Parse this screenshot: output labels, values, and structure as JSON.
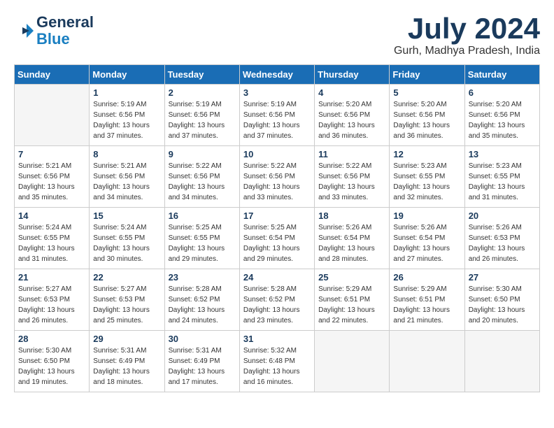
{
  "header": {
    "logo_line1": "General",
    "logo_line2": "Blue",
    "month": "July 2024",
    "location": "Gurh, Madhya Pradesh, India"
  },
  "weekdays": [
    "Sunday",
    "Monday",
    "Tuesday",
    "Wednesday",
    "Thursday",
    "Friday",
    "Saturday"
  ],
  "weeks": [
    [
      {
        "day": "",
        "sunrise": "",
        "sunset": "",
        "daylight": ""
      },
      {
        "day": "1",
        "sunrise": "5:19 AM",
        "sunset": "6:56 PM",
        "daylight": "13 hours and 37 minutes."
      },
      {
        "day": "2",
        "sunrise": "5:19 AM",
        "sunset": "6:56 PM",
        "daylight": "13 hours and 37 minutes."
      },
      {
        "day": "3",
        "sunrise": "5:19 AM",
        "sunset": "6:56 PM",
        "daylight": "13 hours and 37 minutes."
      },
      {
        "day": "4",
        "sunrise": "5:20 AM",
        "sunset": "6:56 PM",
        "daylight": "13 hours and 36 minutes."
      },
      {
        "day": "5",
        "sunrise": "5:20 AM",
        "sunset": "6:56 PM",
        "daylight": "13 hours and 36 minutes."
      },
      {
        "day": "6",
        "sunrise": "5:20 AM",
        "sunset": "6:56 PM",
        "daylight": "13 hours and 35 minutes."
      }
    ],
    [
      {
        "day": "7",
        "sunrise": "5:21 AM",
        "sunset": "6:56 PM",
        "daylight": "13 hours and 35 minutes."
      },
      {
        "day": "8",
        "sunrise": "5:21 AM",
        "sunset": "6:56 PM",
        "daylight": "13 hours and 34 minutes."
      },
      {
        "day": "9",
        "sunrise": "5:22 AM",
        "sunset": "6:56 PM",
        "daylight": "13 hours and 34 minutes."
      },
      {
        "day": "10",
        "sunrise": "5:22 AM",
        "sunset": "6:56 PM",
        "daylight": "13 hours and 33 minutes."
      },
      {
        "day": "11",
        "sunrise": "5:22 AM",
        "sunset": "6:56 PM",
        "daylight": "13 hours and 33 minutes."
      },
      {
        "day": "12",
        "sunrise": "5:23 AM",
        "sunset": "6:55 PM",
        "daylight": "13 hours and 32 minutes."
      },
      {
        "day": "13",
        "sunrise": "5:23 AM",
        "sunset": "6:55 PM",
        "daylight": "13 hours and 31 minutes."
      }
    ],
    [
      {
        "day": "14",
        "sunrise": "5:24 AM",
        "sunset": "6:55 PM",
        "daylight": "13 hours and 31 minutes."
      },
      {
        "day": "15",
        "sunrise": "5:24 AM",
        "sunset": "6:55 PM",
        "daylight": "13 hours and 30 minutes."
      },
      {
        "day": "16",
        "sunrise": "5:25 AM",
        "sunset": "6:55 PM",
        "daylight": "13 hours and 29 minutes."
      },
      {
        "day": "17",
        "sunrise": "5:25 AM",
        "sunset": "6:54 PM",
        "daylight": "13 hours and 29 minutes."
      },
      {
        "day": "18",
        "sunrise": "5:26 AM",
        "sunset": "6:54 PM",
        "daylight": "13 hours and 28 minutes."
      },
      {
        "day": "19",
        "sunrise": "5:26 AM",
        "sunset": "6:54 PM",
        "daylight": "13 hours and 27 minutes."
      },
      {
        "day": "20",
        "sunrise": "5:26 AM",
        "sunset": "6:53 PM",
        "daylight": "13 hours and 26 minutes."
      }
    ],
    [
      {
        "day": "21",
        "sunrise": "5:27 AM",
        "sunset": "6:53 PM",
        "daylight": "13 hours and 26 minutes."
      },
      {
        "day": "22",
        "sunrise": "5:27 AM",
        "sunset": "6:53 PM",
        "daylight": "13 hours and 25 minutes."
      },
      {
        "day": "23",
        "sunrise": "5:28 AM",
        "sunset": "6:52 PM",
        "daylight": "13 hours and 24 minutes."
      },
      {
        "day": "24",
        "sunrise": "5:28 AM",
        "sunset": "6:52 PM",
        "daylight": "13 hours and 23 minutes."
      },
      {
        "day": "25",
        "sunrise": "5:29 AM",
        "sunset": "6:51 PM",
        "daylight": "13 hours and 22 minutes."
      },
      {
        "day": "26",
        "sunrise": "5:29 AM",
        "sunset": "6:51 PM",
        "daylight": "13 hours and 21 minutes."
      },
      {
        "day": "27",
        "sunrise": "5:30 AM",
        "sunset": "6:50 PM",
        "daylight": "13 hours and 20 minutes."
      }
    ],
    [
      {
        "day": "28",
        "sunrise": "5:30 AM",
        "sunset": "6:50 PM",
        "daylight": "13 hours and 19 minutes."
      },
      {
        "day": "29",
        "sunrise": "5:31 AM",
        "sunset": "6:49 PM",
        "daylight": "13 hours and 18 minutes."
      },
      {
        "day": "30",
        "sunrise": "5:31 AM",
        "sunset": "6:49 PM",
        "daylight": "13 hours and 17 minutes."
      },
      {
        "day": "31",
        "sunrise": "5:32 AM",
        "sunset": "6:48 PM",
        "daylight": "13 hours and 16 minutes."
      },
      {
        "day": "",
        "sunrise": "",
        "sunset": "",
        "daylight": ""
      },
      {
        "day": "",
        "sunrise": "",
        "sunset": "",
        "daylight": ""
      },
      {
        "day": "",
        "sunrise": "",
        "sunset": "",
        "daylight": ""
      }
    ]
  ]
}
